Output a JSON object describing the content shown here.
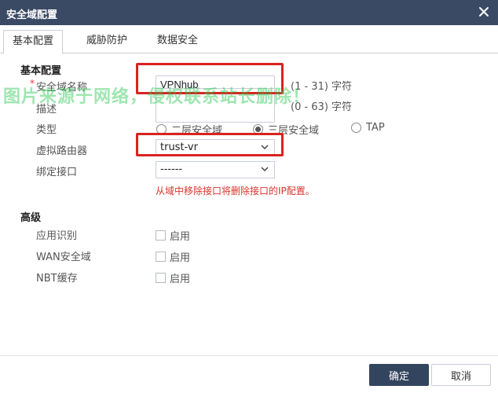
{
  "dialog": {
    "title": "安全域配置",
    "close_icon": "close-icon"
  },
  "tabs": [
    {
      "label": "基本配置",
      "active": true
    },
    {
      "label": "威胁防护",
      "active": false
    },
    {
      "label": "数据安全",
      "active": false
    }
  ],
  "basic": {
    "section_title": "基本配置",
    "name": {
      "label": "安全域名称",
      "required_mark": "*",
      "value": "VPNhub",
      "hint": "(1 - 31) 字符"
    },
    "desc": {
      "label": "描述",
      "value": "",
      "hint": "(0 - 63) 字符"
    },
    "type": {
      "label": "类型",
      "options": [
        {
          "label": "二层安全域",
          "selected": false
        },
        {
          "label": "三层安全域",
          "selected": true
        },
        {
          "label": "TAP",
          "selected": false
        }
      ]
    },
    "vrouter": {
      "label": "虚拟路由器",
      "value": "trust-vr"
    },
    "bind_interface": {
      "label": "绑定接口",
      "value": "------"
    },
    "warning": "从域中移除接口将删除接口的IP配置。"
  },
  "advanced": {
    "section_title": "高级",
    "items": [
      {
        "label": "应用识别",
        "check_label": "启用",
        "checked": false
      },
      {
        "label": "WAN安全域",
        "check_label": "启用",
        "checked": false
      },
      {
        "label": "NBT缓存",
        "check_label": "启用",
        "checked": false
      }
    ]
  },
  "watermark": "图片来源于网络，侵权联系站长删除！",
  "footer": {
    "ok_label": "确定",
    "cancel_label": "取消"
  },
  "colors": {
    "titlebar": "#3a4a64",
    "primary_button": "#33445e",
    "annotation": "#d9231f",
    "warning_text": "#d9342b"
  }
}
